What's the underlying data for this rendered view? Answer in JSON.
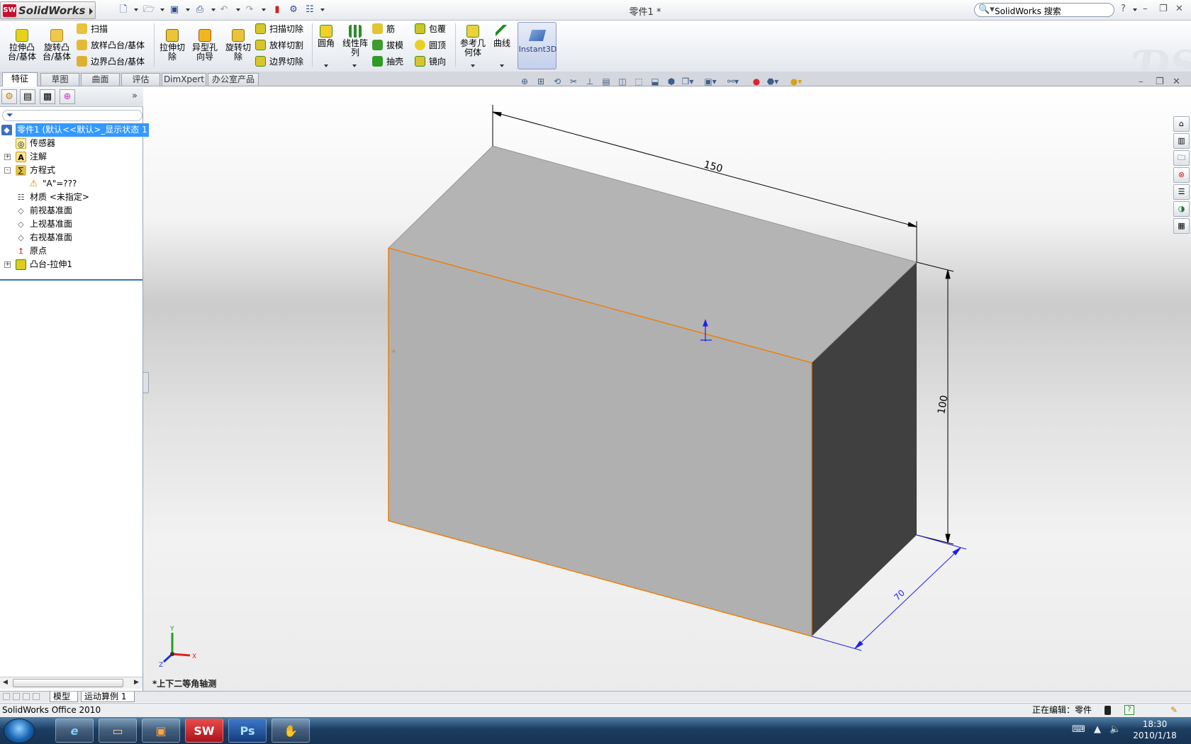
{
  "app": {
    "logo_text": "SolidWorks",
    "logo_badge": "SW",
    "document_title": "零件1 *",
    "search_placeholder": "SolidWorks 搜索",
    "help_symbol": "?"
  },
  "ribbon": {
    "big_buttons": [
      {
        "name": "extrude-boss",
        "label": "拉伸凸\n台/基体"
      },
      {
        "name": "revolve-boss",
        "label": "旋转凸\n台/基体"
      },
      {
        "name": "extrude-cut",
        "label": "拉伸切\n除"
      },
      {
        "name": "hole-wizard",
        "label": "异型孔\n向导"
      },
      {
        "name": "revolve-cut",
        "label": "旋转切\n除"
      },
      {
        "name": "fillet",
        "label": "圆角"
      },
      {
        "name": "linear-pattern",
        "label": "线性阵\n列"
      },
      {
        "name": "reference-geometry",
        "label": "参考几\n何体"
      },
      {
        "name": "curves",
        "label": "曲线"
      }
    ],
    "small_buttons": [
      {
        "name": "sweep",
        "label": "扫描"
      },
      {
        "name": "loft-boss",
        "label": "放样凸台/基体"
      },
      {
        "name": "boundary-boss",
        "label": "边界凸台/基体"
      },
      {
        "name": "swept-cut",
        "label": "扫描切除"
      },
      {
        "name": "lofted-cut",
        "label": "放样切割"
      },
      {
        "name": "boundary-cut",
        "label": "边界切除"
      },
      {
        "name": "rib",
        "label": "筋"
      },
      {
        "name": "draft",
        "label": "拔模"
      },
      {
        "name": "shell",
        "label": "抽壳"
      },
      {
        "name": "wrap",
        "label": "包覆"
      },
      {
        "name": "dome",
        "label": "圆顶"
      },
      {
        "name": "mirror",
        "label": "镜向"
      }
    ],
    "instant3d_label": "Instant3D"
  },
  "tabs": [
    {
      "label": "特征",
      "active": true
    },
    {
      "label": "草图"
    },
    {
      "label": "曲面"
    },
    {
      "label": "评估"
    },
    {
      "label": "DimXpert"
    },
    {
      "label": "办公室产品"
    }
  ],
  "tree": {
    "root_label": "零件1  (默认<<默认>_显示状态 1",
    "items": [
      {
        "label": "传感器"
      },
      {
        "label": "注解"
      },
      {
        "label": "方程式"
      },
      {
        "label": "\"A\"=???"
      },
      {
        "label": "材质 <未指定>"
      },
      {
        "label": "前视基准面"
      },
      {
        "label": "上视基准面"
      },
      {
        "label": "右视基准面"
      },
      {
        "label": "原点"
      },
      {
        "label": "凸台-拉伸1"
      }
    ],
    "expand_symbol": "+",
    "collapse_symbol": "-"
  },
  "bottom_tabs": [
    {
      "label": "模型"
    },
    {
      "label": "运动算例 1"
    }
  ],
  "viewport": {
    "view_name": "*上下二等角轴测",
    "dimensions": [
      {
        "name": "length",
        "value": "150"
      },
      {
        "name": "height",
        "value": "100"
      },
      {
        "name": "depth",
        "value": "70"
      }
    ],
    "triad_labels": {
      "x": "X",
      "y": "Y",
      "z": "Z"
    },
    "colors": {
      "top_face": "#b4b4b4",
      "front_face": "#b0b0b0",
      "side_face": "#404040",
      "edge_highlight": "#f07c00",
      "dimension_line": "#000000",
      "dimension_line_depth": "#1f1ff0"
    }
  },
  "status": {
    "left_text": "SolidWorks Office 2010",
    "editing_text": "正在编辑：零件",
    "help_icon": "?"
  },
  "taskbar": {
    "time": "18:30",
    "date": "2010/1/18",
    "apps": [
      {
        "name": "internet-explorer",
        "label": "e"
      },
      {
        "name": "file-explorer",
        "label": "▭"
      },
      {
        "name": "presentation",
        "label": "▣"
      },
      {
        "name": "solidworks",
        "label": "SW"
      },
      {
        "name": "photoshop",
        "label": "Ps"
      },
      {
        "name": "hand-tool",
        "label": "✋"
      }
    ]
  }
}
